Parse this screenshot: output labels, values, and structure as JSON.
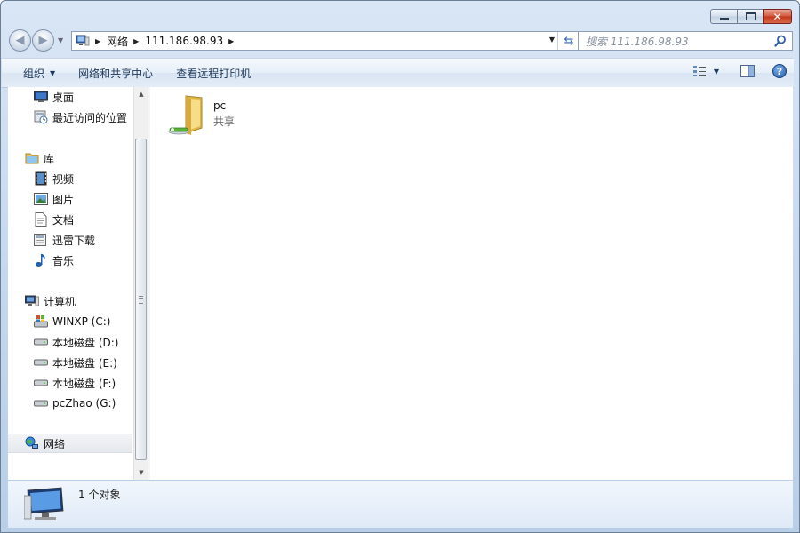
{
  "window": {
    "caption_close": "✕"
  },
  "navbar": {
    "back_glyph": "◀",
    "forward_glyph": "▶",
    "address": {
      "breadcrumbs": [
        "网络",
        "111.186.98.93"
      ],
      "crumb_arrow": "▶",
      "dropdown_glyph": "▼",
      "refresh_glyph": "⇆"
    },
    "search": {
      "placeholder": "搜索 111.186.98.93"
    }
  },
  "commandbar": {
    "organize_label": "组织",
    "network_center_label": "网络和共享中心",
    "printers_label": "查看远程打印机",
    "dropdown_glyph": "▼",
    "help_glyph": "?"
  },
  "navpane": {
    "favorites": [
      {
        "label": "桌面",
        "icon": "desktop-icon"
      },
      {
        "label": "最近访问的位置",
        "icon": "recent-places-icon"
      }
    ],
    "libraries": {
      "label": "库",
      "items": [
        {
          "label": "视频",
          "icon": "video-icon"
        },
        {
          "label": "图片",
          "icon": "pictures-icon"
        },
        {
          "label": "文档",
          "icon": "documents-icon"
        },
        {
          "label": "迅雷下载",
          "icon": "downloads-icon"
        },
        {
          "label": "音乐",
          "icon": "music-icon"
        }
      ]
    },
    "computer": {
      "label": "计算机",
      "items": [
        {
          "label": "WINXP (C:)",
          "icon": "system-drive-icon"
        },
        {
          "label": "本地磁盘 (D:)",
          "icon": "drive-icon"
        },
        {
          "label": "本地磁盘 (E:)",
          "icon": "drive-icon"
        },
        {
          "label": "本地磁盘 (F:)",
          "icon": "drive-icon"
        },
        {
          "label": "pcZhao (G:)",
          "icon": "drive-icon"
        }
      ]
    },
    "network": {
      "label": "网络",
      "selected": true
    }
  },
  "files": [
    {
      "name": "pc",
      "subtitle": "共享",
      "icon": "shared-folder-icon"
    }
  ],
  "details": {
    "status": "1 个对象"
  },
  "colors": {
    "accent": "#2c63b0",
    "window_frame": "#c2d6ee",
    "close_button": "#c4361a"
  }
}
